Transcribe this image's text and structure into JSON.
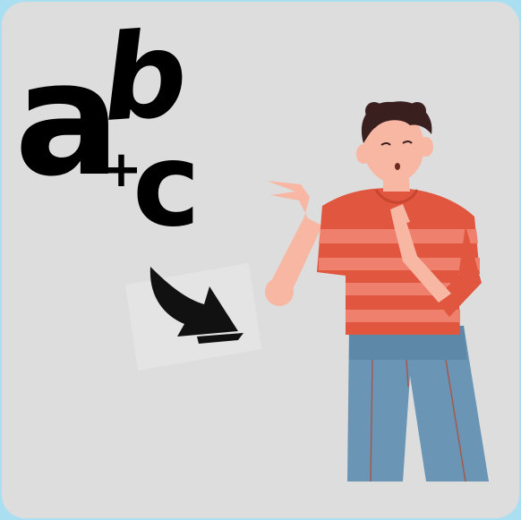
{
  "letters": {
    "a": "a",
    "b": "b",
    "plus": "+",
    "c": "c"
  },
  "colors": {
    "frame": "#a9dff0",
    "card": "#dddddd",
    "ink": "#000000",
    "shirt_red": "#e0563f",
    "shirt_stripe": "#f0806e",
    "skin": "#f7b7a3",
    "hair": "#3a1f1f",
    "jeans": "#6a95b5"
  },
  "icons": {
    "arrow": "curved-arrow-icon",
    "person": "person-illustration"
  }
}
